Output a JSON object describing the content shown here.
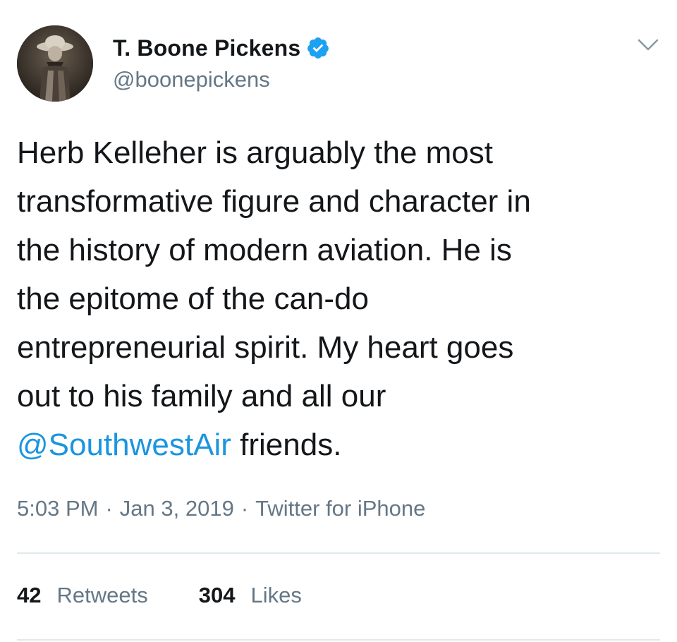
{
  "author": {
    "display_name": "T. Boone Pickens",
    "handle": "@boonepickens",
    "verified": true,
    "verified_icon": "verified-badge-icon",
    "avatar": "avatar-photo"
  },
  "menu_icon": "chevron-down-icon",
  "tweet": {
    "lines": [
      "Herb Kelleher is arguably the most",
      "transformative figure and character in",
      "the history of modern aviation. He is",
      "the epitome of the can-do",
      "entrepreneurial spirit. My heart goes",
      "out to his family and all our"
    ],
    "last_line_mention": "@SouthwestAir",
    "last_line_rest": " friends."
  },
  "meta": {
    "time": "5:03 PM",
    "separator": "·",
    "date": "Jan 3, 2019",
    "source": "Twitter for iPhone"
  },
  "stats": {
    "retweets_count": "42",
    "retweets_label": "Retweets",
    "likes_count": "304",
    "likes_label": "Likes"
  },
  "colors": {
    "text": "#14171a",
    "secondary": "#657786",
    "link": "#1b95e0",
    "verified": "#1da1f2",
    "divider": "#e1e8ed"
  }
}
